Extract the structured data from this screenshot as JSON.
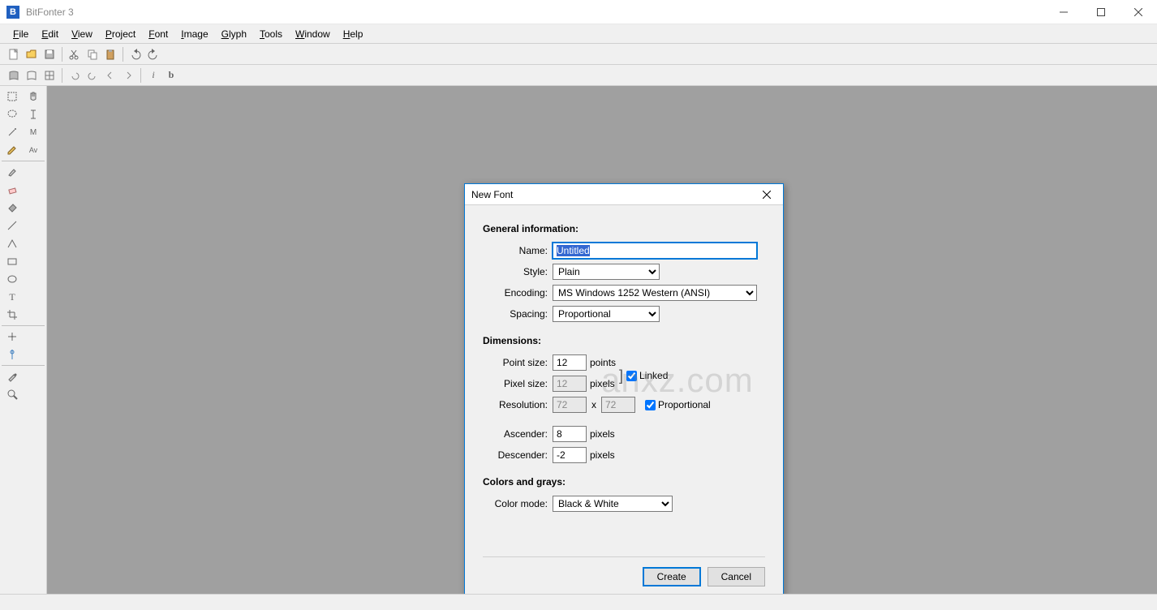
{
  "window": {
    "title": "BitFonter 3",
    "app_icon_letter": "B"
  },
  "menubar": {
    "items": [
      "File",
      "Edit",
      "View",
      "Project",
      "Font",
      "Image",
      "Glyph",
      "Tools",
      "Window",
      "Help"
    ]
  },
  "toolbar1": {
    "icons": [
      "new-file-icon",
      "open-file-icon",
      "save-icon",
      "cut-icon",
      "copy-icon",
      "paste-icon",
      "undo-icon",
      "redo-icon"
    ]
  },
  "toolbar2": {
    "icons": [
      "book-icon",
      "book-outline-icon",
      "grid-icon",
      "undo-icon",
      "redo-icon",
      "back-icon",
      "forward-icon",
      "info-icon",
      "bold-icon"
    ]
  },
  "left_tools": {
    "icons": [
      "marquee-icon",
      "hand-icon",
      "lasso-icon",
      "text-cursor-icon",
      "wand-icon",
      "metrics-icon",
      "pencil-icon",
      "kerning-icon",
      "brush-icon",
      "eraser-icon",
      "fill-icon",
      "line-icon",
      "shape-icon",
      "rect-icon",
      "ellipse-icon",
      "type-icon",
      "crop-icon",
      "transform-icon",
      "guide-icon",
      "eyedropper-icon",
      "zoom-icon"
    ]
  },
  "dialog": {
    "title": "New Font",
    "sections": {
      "general": {
        "heading": "General information:",
        "name_label": "Name:",
        "name_value": "Untitled",
        "style_label": "Style:",
        "style_value": "Plain",
        "encoding_label": "Encoding:",
        "encoding_value": "MS Windows 1252 Western (ANSI)",
        "spacing_label": "Spacing:",
        "spacing_value": "Proportional"
      },
      "dimensions": {
        "heading": "Dimensions:",
        "point_size_label": "Point size:",
        "point_size_value": "12",
        "point_size_units": "points",
        "pixel_size_label": "Pixel size:",
        "pixel_size_value": "12",
        "pixel_size_units": "pixels",
        "linked_label": "Linked",
        "linked_checked": true,
        "resolution_label": "Resolution:",
        "resolution_x": "72",
        "resolution_sep": "x",
        "resolution_y": "72",
        "proportional_label": "Proportional",
        "proportional_checked": true,
        "ascender_label": "Ascender:",
        "ascender_value": "8",
        "ascender_units": "pixels",
        "descender_label": "Descender:",
        "descender_value": "-2",
        "descender_units": "pixels"
      },
      "colors": {
        "heading": "Colors and grays:",
        "color_mode_label": "Color mode:",
        "color_mode_value": "Black & White"
      }
    },
    "buttons": {
      "create": "Create",
      "cancel": "Cancel"
    }
  },
  "watermark": "anxz.com"
}
